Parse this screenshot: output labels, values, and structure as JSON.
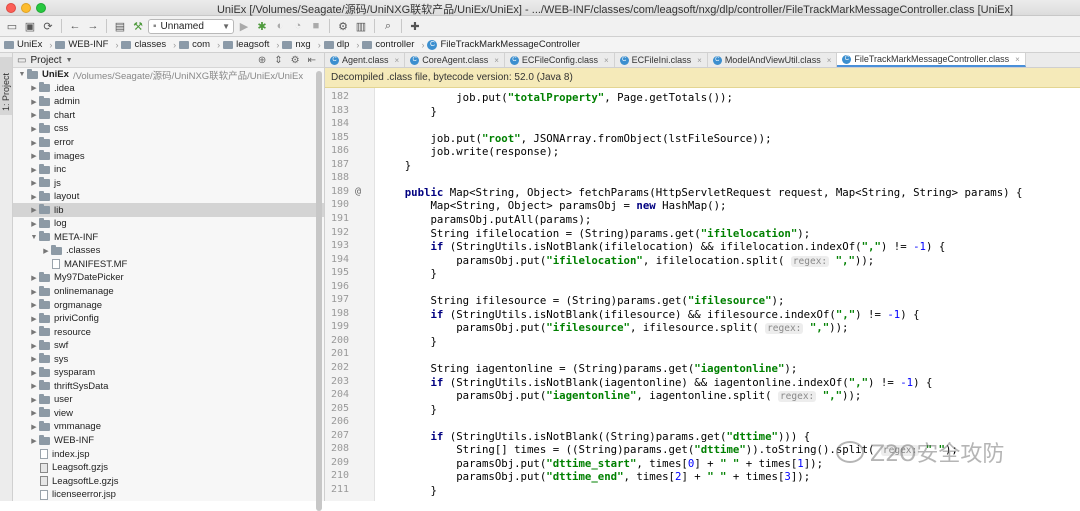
{
  "window": {
    "title": "UniEx [/Volumes/Seagate/源码/UniNXG联软产品/UniEx/UniEx] - .../WEB-INF/classes/com/leagsoft/nxg/dlp/controller/FileTrackMarkMessageController.class [UniEx]"
  },
  "toolbar": {
    "run_config": "Unnamed"
  },
  "breadcrumb": [
    "UniEx",
    "WEB-INF",
    "classes",
    "com",
    "leagsoft",
    "nxg",
    "dlp",
    "controller",
    "FileTrackMarkMessageController"
  ],
  "tool_strip": {
    "project_tab": "1: Project"
  },
  "project_panel": {
    "title": "Project",
    "root": {
      "name": "UniEx",
      "path": "/Volumes/Seagate/源码/UniNXG联软产品/UniEx/UniEx"
    },
    "items": [
      {
        "label": ".idea",
        "type": "folder",
        "indent": 1,
        "arrow": "right"
      },
      {
        "label": "admin",
        "type": "folder",
        "indent": 1,
        "arrow": "right"
      },
      {
        "label": "chart",
        "type": "folder",
        "indent": 1,
        "arrow": "right"
      },
      {
        "label": "css",
        "type": "folder",
        "indent": 1,
        "arrow": "right"
      },
      {
        "label": "error",
        "type": "folder",
        "indent": 1,
        "arrow": "right"
      },
      {
        "label": "images",
        "type": "folder",
        "indent": 1,
        "arrow": "right"
      },
      {
        "label": "inc",
        "type": "folder",
        "indent": 1,
        "arrow": "right"
      },
      {
        "label": "js",
        "type": "folder",
        "indent": 1,
        "arrow": "right"
      },
      {
        "label": "layout",
        "type": "folder",
        "indent": 1,
        "arrow": "right"
      },
      {
        "label": "lib",
        "type": "folder",
        "indent": 1,
        "arrow": "right",
        "selected": true
      },
      {
        "label": "log",
        "type": "folder",
        "indent": 1,
        "arrow": "right"
      },
      {
        "label": "META-INF",
        "type": "folder",
        "indent": 1,
        "arrow": "down"
      },
      {
        "label": ".classes",
        "type": "folder",
        "indent": 2,
        "arrow": "right"
      },
      {
        "label": "MANIFEST.MF",
        "type": "file",
        "indent": 2,
        "arrow": ""
      },
      {
        "label": "My97DatePicker",
        "type": "folder",
        "indent": 1,
        "arrow": "right"
      },
      {
        "label": "onlinemanage",
        "type": "folder",
        "indent": 1,
        "arrow": "right"
      },
      {
        "label": "orgmanage",
        "type": "folder",
        "indent": 1,
        "arrow": "right"
      },
      {
        "label": "priviConfig",
        "type": "folder",
        "indent": 1,
        "arrow": "right"
      },
      {
        "label": "resource",
        "type": "folder",
        "indent": 1,
        "arrow": "right"
      },
      {
        "label": "swf",
        "type": "folder",
        "indent": 1,
        "arrow": "right"
      },
      {
        "label": "sys",
        "type": "folder",
        "indent": 1,
        "arrow": "right"
      },
      {
        "label": "sysparam",
        "type": "folder",
        "indent": 1,
        "arrow": "right"
      },
      {
        "label": "thriftSysData",
        "type": "folder",
        "indent": 1,
        "arrow": "right"
      },
      {
        "label": "user",
        "type": "folder",
        "indent": 1,
        "arrow": "right"
      },
      {
        "label": "view",
        "type": "folder",
        "indent": 1,
        "arrow": "right"
      },
      {
        "label": "vmmanage",
        "type": "folder",
        "indent": 1,
        "arrow": "right"
      },
      {
        "label": "WEB-INF",
        "type": "folder",
        "indent": 1,
        "arrow": "right"
      },
      {
        "label": "index.jsp",
        "type": "file",
        "indent": 1,
        "arrow": ""
      },
      {
        "label": "Leagsoft.gzjs",
        "type": "gz",
        "indent": 1,
        "arrow": ""
      },
      {
        "label": "LeagsoftLe.gzjs",
        "type": "gz",
        "indent": 1,
        "arrow": ""
      },
      {
        "label": "licenseerror.jsp",
        "type": "file",
        "indent": 1,
        "arrow": ""
      }
    ]
  },
  "editor_tabs": [
    {
      "label": "Agent.class",
      "active": false
    },
    {
      "label": "CoreAgent.class",
      "active": false
    },
    {
      "label": "ECFileConfig.class",
      "active": false
    },
    {
      "label": "ECFileIni.class",
      "active": false
    },
    {
      "label": "ModelAndViewUtil.class",
      "active": false
    },
    {
      "label": "FileTrackMarkMessageController.class",
      "active": true
    }
  ],
  "notice": "Decompiled .class file, bytecode version: 52.0 (Java 8)",
  "code_lines": [
    {
      "n": "182",
      "html": "            job.put(<span class='st'>\"totalProperty\"</span>, Page.getTotals());"
    },
    {
      "n": "183",
      "html": "        }"
    },
    {
      "n": "184",
      "html": ""
    },
    {
      "n": "185",
      "html": "        job.put(<span class='st'>\"root\"</span>, JSONArray.fromObject(lstFileSource));"
    },
    {
      "n": "186",
      "html": "        job.write(response);"
    },
    {
      "n": "187",
      "html": "    }"
    },
    {
      "n": "188",
      "html": ""
    },
    {
      "n": "189",
      "html": "    <span class='kw'>public</span> Map&lt;String, Object&gt; fetchParams(HttpServletRequest request, Map&lt;String, String&gt; params) {",
      "mark": "@"
    },
    {
      "n": "190",
      "html": "        Map&lt;String, Object&gt; paramsObj = <span class='kw'>new</span> HashMap();"
    },
    {
      "n": "191",
      "html": "        paramsObj.putAll(params);"
    },
    {
      "n": "192",
      "html": "        String ifilelocation = (String)params.get(<span class='st'>\"ifilelocation\"</span>);"
    },
    {
      "n": "193",
      "html": "        <span class='kw'>if</span> (StringUtils.isNotBlank(ifilelocation) &amp;&amp; ifilelocation.indexOf(<span class='st'>\",\"</span>) != <span class='nm'>-1</span>) {"
    },
    {
      "n": "194",
      "html": "            paramsObj.put(<span class='st'>\"ifilelocation\"</span>, ifilelocation.split( <span class='hint'>regex:</span> <span class='st'>\",\"</span>));"
    },
    {
      "n": "195",
      "html": "        }"
    },
    {
      "n": "196",
      "html": ""
    },
    {
      "n": "197",
      "html": "        String ifilesource = (String)params.get(<span class='st'>\"ifilesource\"</span>);"
    },
    {
      "n": "198",
      "html": "        <span class='kw'>if</span> (StringUtils.isNotBlank(ifilesource) &amp;&amp; ifilesource.indexOf(<span class='st'>\",\"</span>) != <span class='nm'>-1</span>) {"
    },
    {
      "n": "199",
      "html": "            paramsObj.put(<span class='st'>\"ifilesource\"</span>, ifilesource.split( <span class='hint'>regex:</span> <span class='st'>\",\"</span>));"
    },
    {
      "n": "200",
      "html": "        }"
    },
    {
      "n": "201",
      "html": ""
    },
    {
      "n": "202",
      "html": "        String iagentonline = (String)params.get(<span class='st'>\"iagentonline\"</span>);"
    },
    {
      "n": "203",
      "html": "        <span class='kw'>if</span> (StringUtils.isNotBlank(iagentonline) &amp;&amp; iagentonline.indexOf(<span class='st'>\",\"</span>) != <span class='nm'>-1</span>) {"
    },
    {
      "n": "204",
      "html": "            paramsObj.put(<span class='st'>\"iagentonline\"</span>, iagentonline.split( <span class='hint'>regex:</span> <span class='st'>\",\"</span>));"
    },
    {
      "n": "205",
      "html": "        }"
    },
    {
      "n": "206",
      "html": ""
    },
    {
      "n": "207",
      "html": "        <span class='kw'>if</span> (StringUtils.isNotBlank((String)params.get(<span class='st'>\"dttime\"</span>))) {"
    },
    {
      "n": "208",
      "html": "            String[] times = ((String)params.get(<span class='st'>\"dttime\"</span>)).toString().split( <span class='hint'>regex:</span> <span class='st'>\" \"</span>);"
    },
    {
      "n": "209",
      "html": "            paramsObj.put(<span class='st'>\"dttime_start\"</span>, times[<span class='nm'>0</span>] + <span class='st'>\" \"</span> + times[<span class='nm'>1</span>]);"
    },
    {
      "n": "210",
      "html": "            paramsObj.put(<span class='st'>\"dttime_end\"</span>, times[<span class='nm'>2</span>] + <span class='st'>\" \"</span> + times[<span class='nm'>3</span>]);"
    },
    {
      "n": "211",
      "html": "        }"
    }
  ],
  "watermark": "Z2O安全攻防"
}
